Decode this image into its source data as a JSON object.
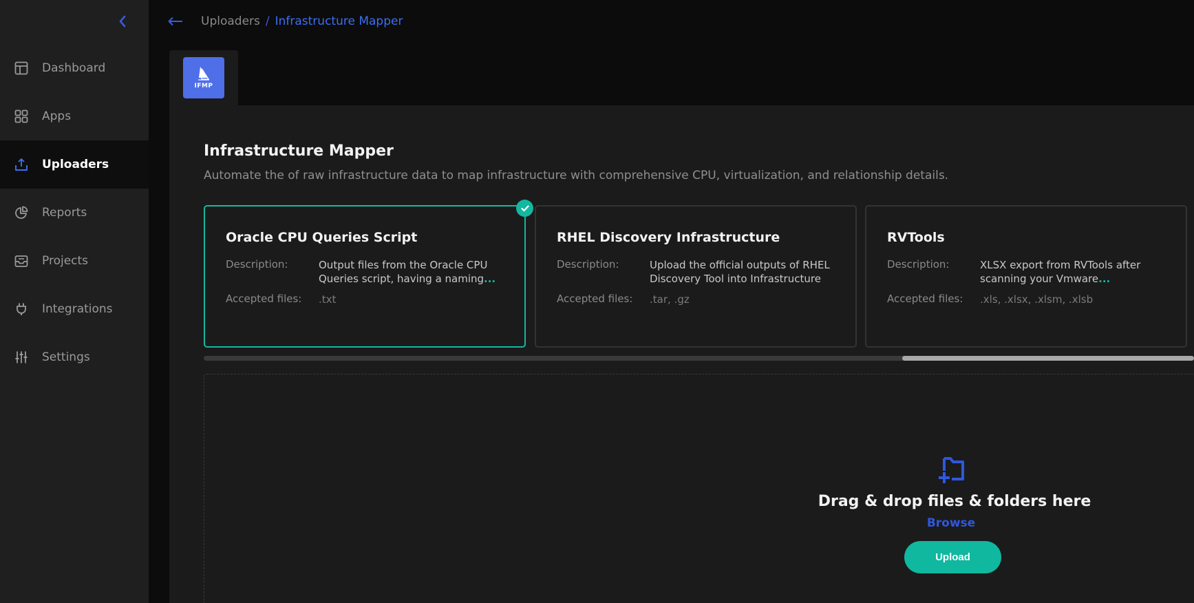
{
  "sidebar": {
    "items": [
      {
        "label": "Dashboard",
        "icon": "dashboard-icon"
      },
      {
        "label": "Apps",
        "icon": "apps-grid-icon"
      },
      {
        "label": "Uploaders",
        "icon": "upload-icon",
        "active": true
      },
      {
        "label": "Reports",
        "icon": "pie-chart-icon"
      },
      {
        "label": "Projects",
        "icon": "inbox-icon"
      },
      {
        "label": "Integrations",
        "icon": "plug-icon"
      },
      {
        "label": "Settings",
        "icon": "sliders-icon"
      }
    ]
  },
  "breadcrumb": {
    "parent": "Uploaders",
    "separator": "/",
    "current": "Infrastructure Mapper"
  },
  "tab": {
    "logo_text": "IFMP"
  },
  "main": {
    "title": "Infrastructure Mapper",
    "subtitle": "Automate the of raw infrastructure data to map infrastructure with comprehensive CPU, virtualization, and relationship details."
  },
  "cards": [
    {
      "title": "Oracle CPU Queries Script",
      "description_label": "Description:",
      "description": "Output files from the Oracle CPU Queries script, having a naming",
      "more": "...",
      "files_label": "Accepted files:",
      "files": ".txt",
      "selected": true
    },
    {
      "title": "RHEL Discovery Infrastructure",
      "description_label": "Description:",
      "description": "Upload the official outputs of RHEL Discovery Tool into Infrastructure",
      "more": "",
      "files_label": "Accepted files:",
      "files": ".tar, .gz",
      "selected": false
    },
    {
      "title": "RVTools",
      "description_label": "Description:",
      "description": "XLSX export from RVTools after scanning your Vmware",
      "more": "...",
      "files_label": "Accepted files:",
      "files": ".xls, .xlsx, .xlsm, .xlsb",
      "selected": false
    }
  ],
  "dropzone": {
    "title": "Drag & drop files & folders here",
    "browse": "Browse",
    "upload_button": "Upload"
  },
  "colors": {
    "accent_blue": "#3b5bdb",
    "accent_teal": "#14b8a0",
    "sidebar_bg": "#1f1f1f",
    "panel_bg": "#1b1b1b"
  }
}
